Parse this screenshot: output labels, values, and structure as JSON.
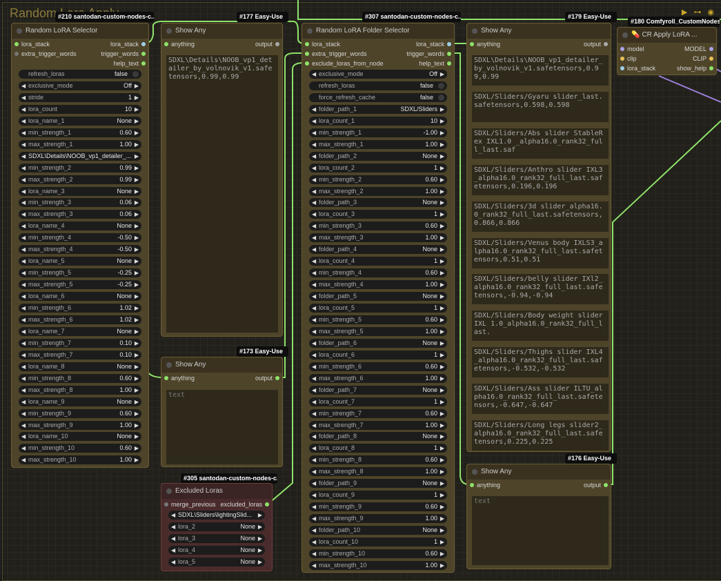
{
  "group": {
    "title": "Random Lora Apply"
  },
  "badges": {
    "b210": "#210 santodan-custom-nodes-c...",
    "b177": "#177 Easy-Use",
    "b307": "#307 santodan-custom-nodes-c...",
    "b179": "#179 Easy-Use",
    "b180": "#180 Comfyroll_CustomNodes",
    "b173": "#173 Easy-Use",
    "b305": "#305 santodan-custom-nodes-c...",
    "b176": "#176 Easy-Use"
  },
  "selector": {
    "title": "Random LoRA Selector",
    "inputs": [
      "lora_stack",
      "extra_trigger_words"
    ],
    "outputs": [
      "lora_stack",
      "trigger_words",
      "help_text"
    ],
    "widgets": [
      {
        "name": "refresh_loras",
        "value": "false",
        "kind": "toggle"
      },
      {
        "name": "exclusive_mode",
        "value": "Off",
        "kind": "arrow"
      },
      {
        "name": "stride",
        "value": "1",
        "kind": "arrow"
      },
      {
        "name": "lora_count",
        "value": "10",
        "kind": "arrow"
      },
      {
        "name": "lora_name_1",
        "value": "None",
        "kind": "arrow"
      },
      {
        "name": "min_strength_1",
        "value": "0.60",
        "kind": "arrow"
      },
      {
        "name": "max_strength_1",
        "value": "1.00",
        "kind": "arrow"
      },
      {
        "name": "",
        "value": "SDXL\\Details\\NOOB_vp1_detailer_...",
        "kind": "combo"
      },
      {
        "name": "min_strength_2",
        "value": "0.99",
        "kind": "arrow"
      },
      {
        "name": "max_strength_2",
        "value": "0.99",
        "kind": "arrow"
      },
      {
        "name": "lora_name_3",
        "value": "None",
        "kind": "arrow"
      },
      {
        "name": "min_strength_3",
        "value": "0.06",
        "kind": "arrow"
      },
      {
        "name": "max_strength_3",
        "value": "0.06",
        "kind": "arrow"
      },
      {
        "name": "lora_name_4",
        "value": "None",
        "kind": "arrow"
      },
      {
        "name": "min_strength_4",
        "value": "-0.50",
        "kind": "arrow"
      },
      {
        "name": "max_strength_4",
        "value": "-0.50",
        "kind": "arrow"
      },
      {
        "name": "lora_name_5",
        "value": "None",
        "kind": "arrow"
      },
      {
        "name": "min_strength_5",
        "value": "-0.25",
        "kind": "arrow"
      },
      {
        "name": "max_strength_5",
        "value": "-0.25",
        "kind": "arrow"
      },
      {
        "name": "lora_name_6",
        "value": "None",
        "kind": "arrow"
      },
      {
        "name": "min_strength_6",
        "value": "1.02",
        "kind": "arrow"
      },
      {
        "name": "max_strength_6",
        "value": "1.02",
        "kind": "arrow"
      },
      {
        "name": "lora_name_7",
        "value": "None",
        "kind": "arrow"
      },
      {
        "name": "min_strength_7",
        "value": "0.10",
        "kind": "arrow"
      },
      {
        "name": "max_strength_7",
        "value": "0.10",
        "kind": "arrow"
      },
      {
        "name": "lora_name_8",
        "value": "None",
        "kind": "arrow"
      },
      {
        "name": "min_strength_8",
        "value": "0.60",
        "kind": "arrow"
      },
      {
        "name": "max_strength_8",
        "value": "1.00",
        "kind": "arrow"
      },
      {
        "name": "lora_name_9",
        "value": "None",
        "kind": "arrow"
      },
      {
        "name": "min_strength_9",
        "value": "0.60",
        "kind": "arrow"
      },
      {
        "name": "max_strength_9",
        "value": "1.00",
        "kind": "arrow"
      },
      {
        "name": "lora_name_10",
        "value": "None",
        "kind": "arrow"
      },
      {
        "name": "min_strength_10",
        "value": "0.60",
        "kind": "arrow"
      },
      {
        "name": "max_strength_10",
        "value": "1.00",
        "kind": "arrow"
      }
    ]
  },
  "showAny177": {
    "title": "Show Any",
    "input": "anything",
    "output": "output",
    "text": "SDXL\\Details\\NOOB_vp1_detailer_by_volnovik_v1.safetensors,0.99,0.99"
  },
  "showAny173": {
    "title": "Show Any",
    "input": "anything",
    "output": "output",
    "placeholder": "text"
  },
  "excluded": {
    "title": "Excluded Loras",
    "input": "merge_previous",
    "output": "excluded_loras",
    "widgets": [
      {
        "name": "",
        "value": "SDXL\\Sliders\\lightingSlid...",
        "kind": "combo"
      },
      {
        "name": "lora_2",
        "value": "None",
        "kind": "arrow"
      },
      {
        "name": "lora_3",
        "value": "None",
        "kind": "arrow"
      },
      {
        "name": "lora_4",
        "value": "None",
        "kind": "arrow"
      },
      {
        "name": "lora_5",
        "value": "None",
        "kind": "arrow"
      }
    ]
  },
  "folder": {
    "title": "Random LoRA Folder Selector",
    "inputs": [
      "lora_stack",
      "extra_trigger_words",
      "exclude_loras_from_node"
    ],
    "outputs": [
      "lora_stack",
      "trigger_words",
      "help_text"
    ],
    "widgets": [
      {
        "name": "exclusive_mode",
        "value": "Off",
        "kind": "arrow"
      },
      {
        "name": "refresh_loras",
        "value": "false",
        "kind": "toggle"
      },
      {
        "name": "force_refresh_cache",
        "value": "false",
        "kind": "toggle"
      },
      {
        "name": "folder_path_1",
        "value": "SDXL/Sliders",
        "kind": "arrow"
      },
      {
        "name": "lora_count_1",
        "value": "10",
        "kind": "arrow"
      },
      {
        "name": "min_strength_1",
        "value": "-1.00",
        "kind": "arrow"
      },
      {
        "name": "max_strength_1",
        "value": "1.00",
        "kind": "arrow"
      },
      {
        "name": "folder_path_2",
        "value": "None",
        "kind": "arrow"
      },
      {
        "name": "lora_count_2",
        "value": "1",
        "kind": "arrow"
      },
      {
        "name": "min_strength_2",
        "value": "0.60",
        "kind": "arrow"
      },
      {
        "name": "max_strength_2",
        "value": "1.00",
        "kind": "arrow"
      },
      {
        "name": "folder_path_3",
        "value": "None",
        "kind": "arrow"
      },
      {
        "name": "lora_count_3",
        "value": "1",
        "kind": "arrow"
      },
      {
        "name": "min_strength_3",
        "value": "0.60",
        "kind": "arrow"
      },
      {
        "name": "max_strength_3",
        "value": "1.00",
        "kind": "arrow"
      },
      {
        "name": "folder_path_4",
        "value": "None",
        "kind": "arrow"
      },
      {
        "name": "lora_count_4",
        "value": "1",
        "kind": "arrow"
      },
      {
        "name": "min_strength_4",
        "value": "0.60",
        "kind": "arrow"
      },
      {
        "name": "max_strength_4",
        "value": "1.00",
        "kind": "arrow"
      },
      {
        "name": "folder_path_5",
        "value": "None",
        "kind": "arrow"
      },
      {
        "name": "lora_count_5",
        "value": "1",
        "kind": "arrow"
      },
      {
        "name": "min_strength_5",
        "value": "0.60",
        "kind": "arrow"
      },
      {
        "name": "max_strength_5",
        "value": "1.00",
        "kind": "arrow"
      },
      {
        "name": "folder_path_6",
        "value": "None",
        "kind": "arrow"
      },
      {
        "name": "lora_count_6",
        "value": "1",
        "kind": "arrow"
      },
      {
        "name": "min_strength_6",
        "value": "0.60",
        "kind": "arrow"
      },
      {
        "name": "max_strength_6",
        "value": "1.00",
        "kind": "arrow"
      },
      {
        "name": "folder_path_7",
        "value": "None",
        "kind": "arrow"
      },
      {
        "name": "lora_count_7",
        "value": "1",
        "kind": "arrow"
      },
      {
        "name": "min_strength_7",
        "value": "0.60",
        "kind": "arrow"
      },
      {
        "name": "max_strength_7",
        "value": "1.00",
        "kind": "arrow"
      },
      {
        "name": "folder_path_8",
        "value": "None",
        "kind": "arrow"
      },
      {
        "name": "lora_count_8",
        "value": "1",
        "kind": "arrow"
      },
      {
        "name": "min_strength_8",
        "value": "0.60",
        "kind": "arrow"
      },
      {
        "name": "max_strength_8",
        "value": "1.00",
        "kind": "arrow"
      },
      {
        "name": "folder_path_9",
        "value": "None",
        "kind": "arrow"
      },
      {
        "name": "lora_count_9",
        "value": "1",
        "kind": "arrow"
      },
      {
        "name": "min_strength_9",
        "value": "0.60",
        "kind": "arrow"
      },
      {
        "name": "max_strength_9",
        "value": "1.00",
        "kind": "arrow"
      },
      {
        "name": "folder_path_10",
        "value": "None",
        "kind": "arrow"
      },
      {
        "name": "lora_count_10",
        "value": "1",
        "kind": "arrow"
      },
      {
        "name": "min_strength_10",
        "value": "0.60",
        "kind": "arrow"
      },
      {
        "name": "max_strength_10",
        "value": "1.00",
        "kind": "arrow"
      }
    ]
  },
  "showAny179": {
    "title": "Show Any",
    "input": "anything",
    "output": "output",
    "texts": [
      "SDXL\\Details\\NOOB_vp1_detailer_by_volnovik_v1.safetensors,0.99,0.99",
      "SDXL/Sliders/Gyaru slider_last.safetensors,0.598,0.598",
      "SDXL/Sliders/Abs slider StableRex IXL1.0 _alpha16.0_rank32_full_last.saf",
      "SDXL/Sliders/Anthro slider IXL3_alpha16.0_rank32_full_last.safetensors,0.196,0.196",
      "SDXL/Sliders/3d slider_alpha16.0_rank32_full_last.safetensors,0.866,0.866",
      "SDXL/Sliders/Venus body IXLS3_alpha16.0_rank32_full_last.safetensors,0.51,0.51",
      "SDXL/Sliders/belly slider IXl2_alpha16.0_rank32_full_last.safetensors,-0.94,-0.94",
      "SDXL/Sliders/Body weight slider IXL 1.0_alpha16.0_rank32_full_last.",
      "SDXL/Sliders/Thighs slider IXL4_alpha16.0_rank32_full_last.safetensors,-0.532,-0.532",
      "SDXL/Sliders/Ass slider ILTU_alpha16.0_rank32_full_last.safetensors,-0.647,-0.647",
      "SDXL/Sliders/Long legs slider2_alpha16.0_rank32_full_last.safetensors,0.225,0.225"
    ]
  },
  "showAny176": {
    "title": "Show Any",
    "input": "anything",
    "output": "output",
    "placeholder": "text"
  },
  "crApply": {
    "title": "CR Apply LoRA ...",
    "inputs": [
      "model",
      "clip",
      "lora_stack"
    ],
    "outputs": [
      "MODEL",
      "CLIP",
      "show_help"
    ]
  },
  "colors": {
    "wire": "#8fe36a",
    "canvas": "#1a1a1a",
    "node": "#4e4429",
    "nodeRed": "#4a2b2b",
    "badge": "#0d0d0d",
    "group": "#8a7a3c"
  }
}
